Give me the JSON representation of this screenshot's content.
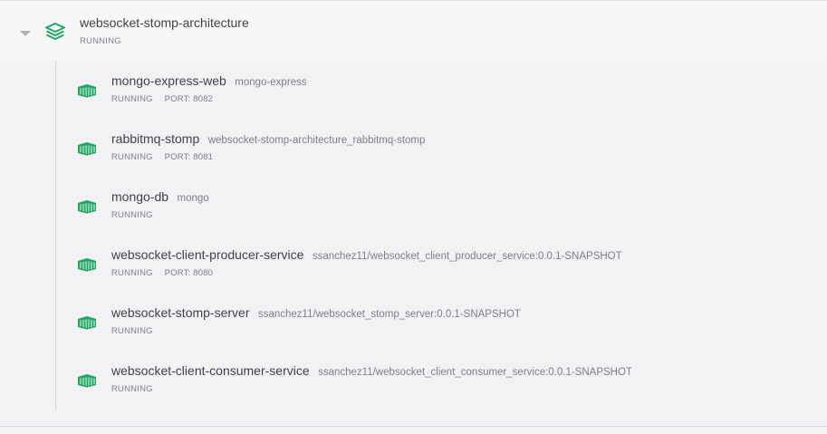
{
  "app": {
    "name": "websocket-stomp-architecture",
    "status": "RUNNING",
    "icon": "stack-icon",
    "accent_color": "#20a566"
  },
  "services": [
    {
      "name": "mongo-express-web",
      "image": "mongo-express",
      "status": "RUNNING",
      "port": "PORT: 8082"
    },
    {
      "name": "rabbitmq-stomp",
      "image": "websocket-stomp-architecture_rabbitmq-stomp",
      "status": "RUNNING",
      "port": "PORT: 8081"
    },
    {
      "name": "mongo-db",
      "image": "mongo",
      "status": "RUNNING",
      "port": null
    },
    {
      "name": "websocket-client-producer-service",
      "image": "ssanchez11/websocket_client_producer_service:0.0.1-SNAPSHOT",
      "status": "RUNNING",
      "port": "PORT: 8080"
    },
    {
      "name": "websocket-stomp-server",
      "image": "ssanchez11/websocket_stomp_server:0.0.1-SNAPSHOT",
      "status": "RUNNING",
      "port": null
    },
    {
      "name": "websocket-client-consumer-service",
      "image": "ssanchez11/websocket_client_consumer_service:0.0.1-SNAPSHOT",
      "status": "RUNNING",
      "port": null
    }
  ]
}
